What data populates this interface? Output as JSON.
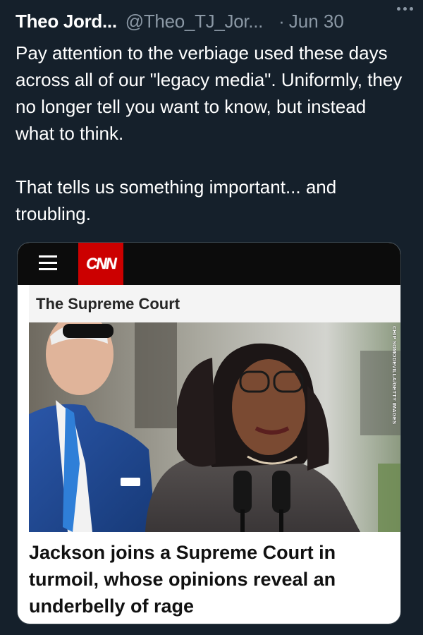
{
  "tweet": {
    "display_name": "Theo Jord...",
    "handle": "@Theo_TJ_Jor...",
    "separator": "·",
    "date": "Jun 30",
    "more_icon": "more-horizontal-icon",
    "text": "Pay attention to the verbiage used these days across all of our \"legacy media\". Uniformly, they no longer tell you want to know, but instead what to think.\n\nThat tells us something important... and troubling."
  },
  "card": {
    "brand_logo": "CNN",
    "menu_icon": "hamburger-menu-icon",
    "section": "The Supreme Court",
    "photo_credit": "CHIP SOMODEVILLA/GETTY IMAGES",
    "headline": "Jackson joins a Supreme Court in turmoil, whose opinions reveal an underbelly of rage"
  },
  "colors": {
    "background": "#15202b",
    "text": "#ffffff",
    "secondary_text": "#8b98a5",
    "cnn_red": "#cc0000",
    "card_border": "#38444d"
  }
}
